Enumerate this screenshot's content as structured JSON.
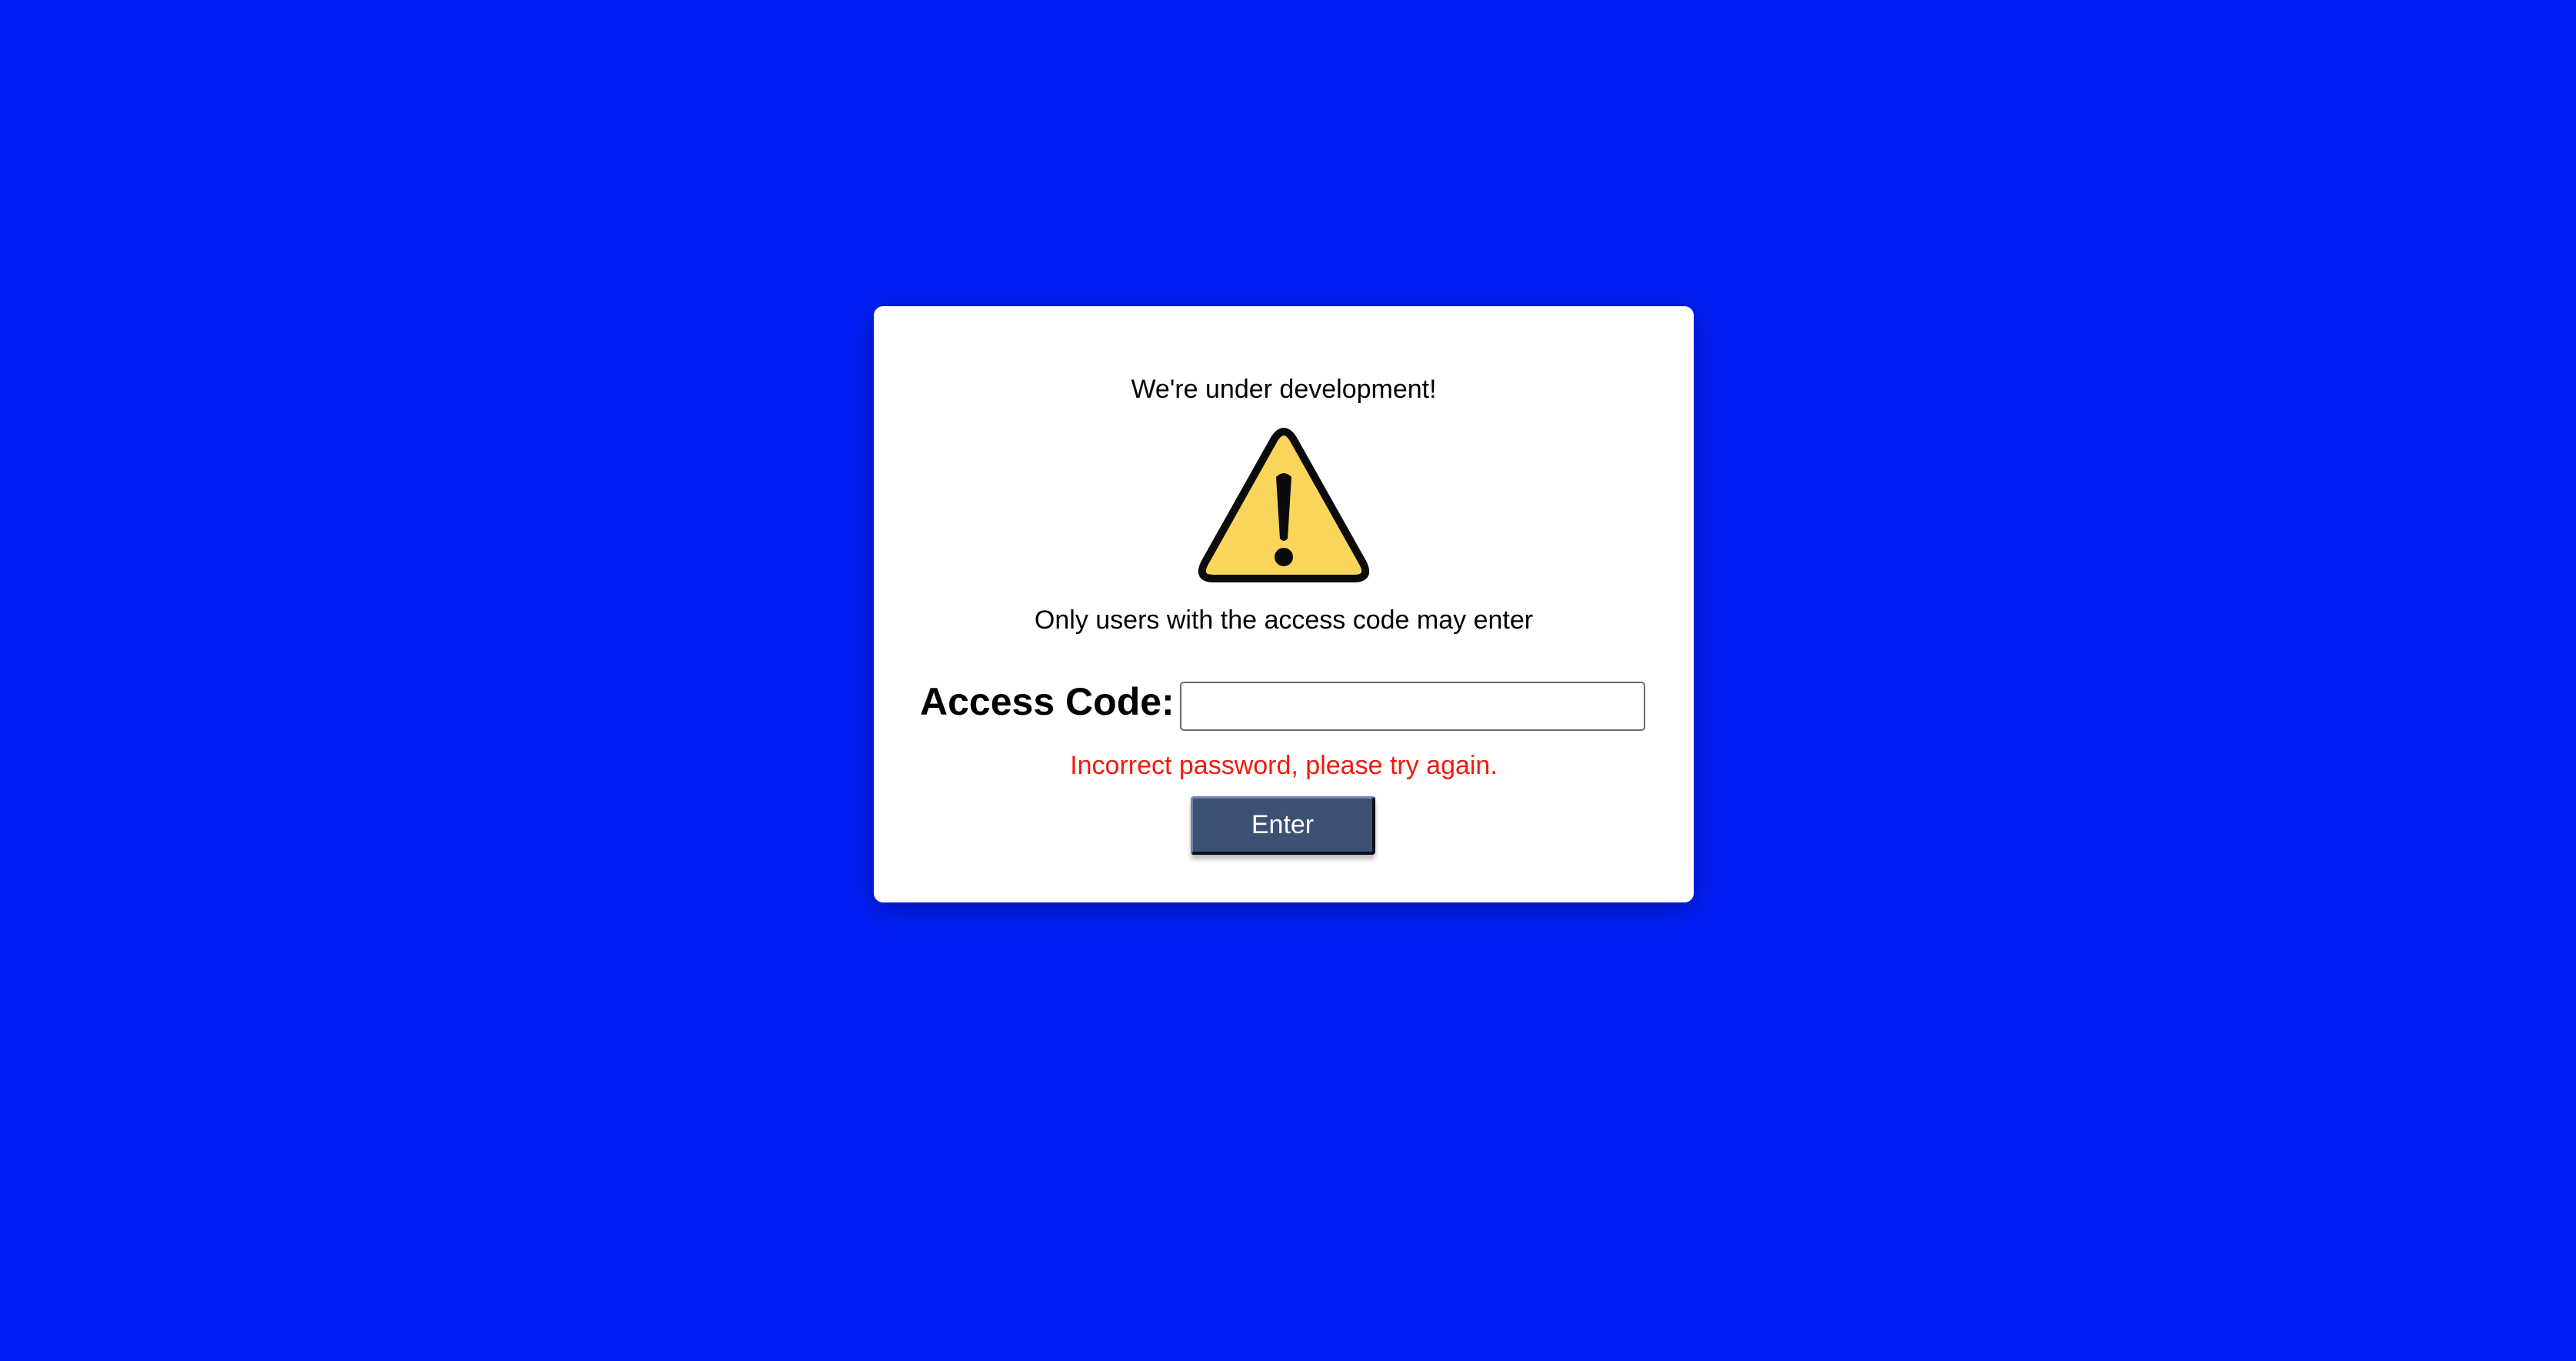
{
  "page": {
    "background_color": "#001ef5"
  },
  "card": {
    "heading": "We're under development!",
    "warning_icon": "warning-triangle-icon",
    "subtext": "Only users with the access code may enter",
    "access_label": "Access Code:",
    "access_input_value": "",
    "access_input_placeholder": "",
    "error_message": "Incorrect password, please try again.",
    "error_color": "#f2190d",
    "enter_button_label": "Enter",
    "button_color": "#3c5174"
  }
}
